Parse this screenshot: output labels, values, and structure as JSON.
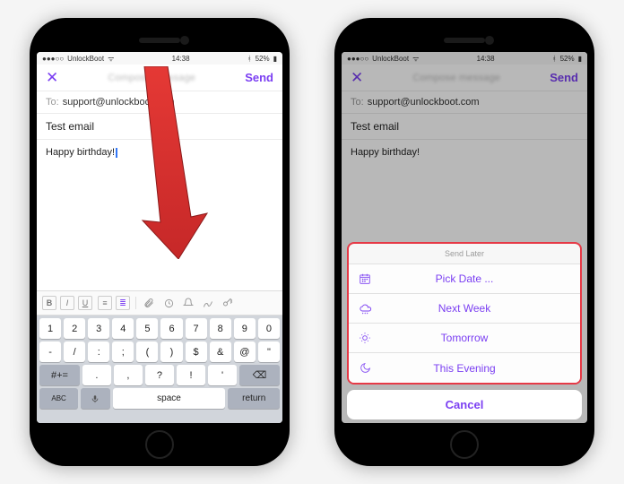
{
  "statusbar": {
    "carrier": "UnlockBoot",
    "time": "14:38",
    "battery": "52%"
  },
  "navbar": {
    "title_blurred": "Compose message",
    "send_label": "Send"
  },
  "compose": {
    "to_label": "To:",
    "to_value": "support@unlockboot.com",
    "subject": "Test email",
    "body": "Happy birthday!"
  },
  "toolbar": {
    "bold": "B",
    "italic": "I",
    "underline": "U",
    "later_label": "Later"
  },
  "keyboard": {
    "row_num": [
      "1",
      "2",
      "3",
      "4",
      "5",
      "6",
      "7",
      "8",
      "9",
      "0"
    ],
    "row_sym1": [
      "-",
      "/",
      ":",
      ";",
      "(",
      ")",
      "$",
      "&",
      "@",
      "\""
    ],
    "row_sym2": [
      ".",
      ",",
      "?",
      "!",
      "'"
    ],
    "shift_alt": "#+=",
    "backspace": "⌫",
    "abc": "ABC",
    "space": "space",
    "return": "return"
  },
  "action_sheet": {
    "header": "Send Later",
    "items": [
      {
        "label": "Pick Date ...",
        "icon": "calendar-icon"
      },
      {
        "label": "Next Week",
        "icon": "cloud-icon"
      },
      {
        "label": "Tomorrow",
        "icon": "sun-icon"
      },
      {
        "label": "This Evening",
        "icon": "moon-icon"
      }
    ],
    "cancel": "Cancel"
  }
}
